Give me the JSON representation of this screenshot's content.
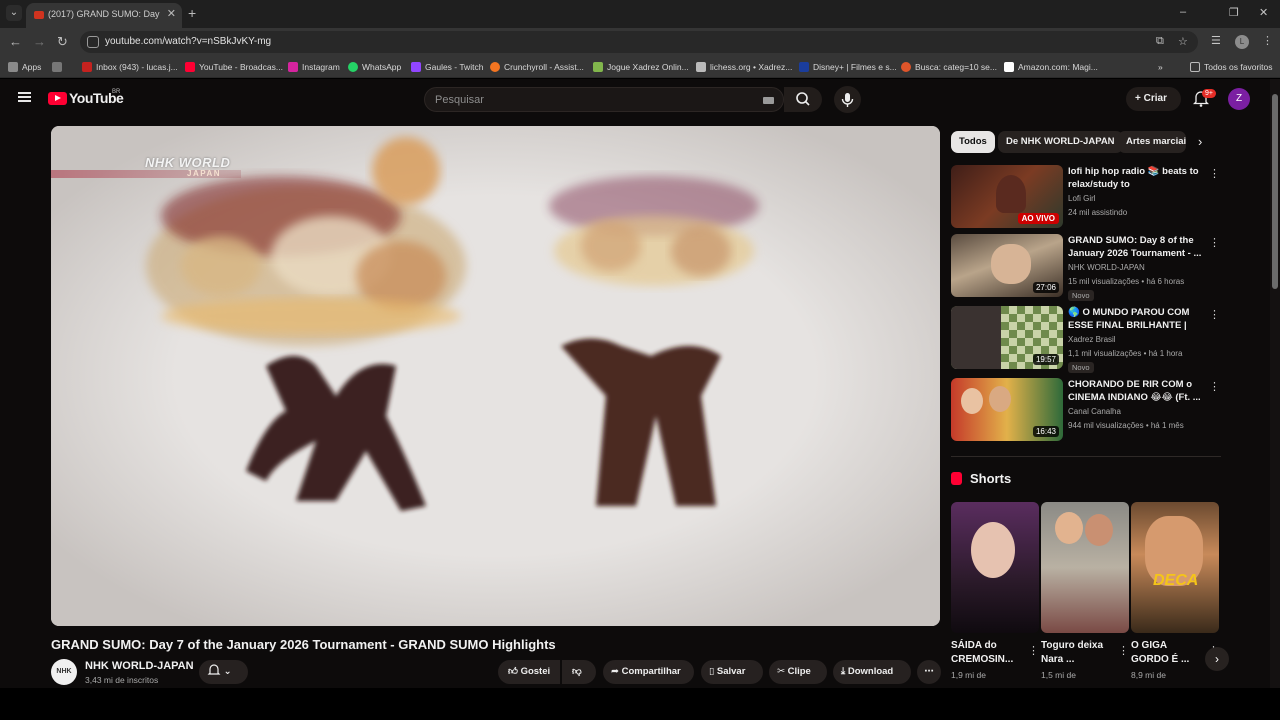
{
  "browser": {
    "tab_title": "(2017) GRAND SUMO: Day 7 of the January 2026 Tournament",
    "url": "youtube.com/watch?v=nSBkJvKY-mg",
    "profile_initial": "L",
    "bookmarks": [
      {
        "label": "Apps",
        "color": "#8a8a8a"
      },
      {
        "label": "Inbox (943) - lucas.j...",
        "color": "#c5221f"
      },
      {
        "label": "YouTube - Broadcas...",
        "color": "#ff0033"
      },
      {
        "label": "Instagram",
        "color": "#d6249f"
      },
      {
        "label": "WhatsApp",
        "color": "#25d366"
      },
      {
        "label": "Gaules - Twitch",
        "color": "#9146ff"
      },
      {
        "label": "Crunchyroll - Assist...",
        "color": "#f47521"
      },
      {
        "label": "Jogue Xadrez Onlin...",
        "color": "#81b64c"
      },
      {
        "label": "lichess.org • Xadrez...",
        "color": "#bbbbbb"
      },
      {
        "label": "Disney+ | Filmes e s...",
        "color": "#1a3d9c"
      },
      {
        "label": "Busca: categ=10 se...",
        "color": "#e0552a"
      },
      {
        "label": "Amazon.com: Magi...",
        "color": "#ffffff"
      }
    ],
    "all_bookmarks": "Todos os favoritos"
  },
  "masthead": {
    "logo_text": "YouTube",
    "country": "BR",
    "search_placeholder": "Pesquisar",
    "create_label": "Criar",
    "notif_badge": "9+",
    "avatar_initial": "Z"
  },
  "player": {
    "watermark_main": "NHK WORLD",
    "watermark_sub": "JAPAN"
  },
  "video": {
    "title": "GRAND SUMO: Day 7 of the January 2026 Tournament - GRAND SUMO Highlights",
    "channel": "NHK WORLD-JAPAN",
    "channel_avatar": "NHK",
    "subscribers": "3,43 mi de inscritos",
    "actions": {
      "like": "Gostei",
      "share": "Compartilhar",
      "save": "Salvar",
      "clip": "Clipe",
      "download": "Download"
    }
  },
  "chips": [
    "Todos",
    "De NHK WORLD-JAPAN",
    "Artes marciais"
  ],
  "recommendations": [
    {
      "title": "lofi hip hop radio 📚 beats to relax/study to",
      "channel": "Lofi Girl",
      "meta": "24 mil assistindo",
      "badge": "AO VIVO",
      "tag": ""
    },
    {
      "title": "GRAND SUMO: Day 8 of the January 2026 Tournament - ...",
      "channel": "NHK WORLD-JAPAN",
      "meta": "15 mil visualizações • há 6 horas",
      "badge": "27:06",
      "tag": "Novo"
    },
    {
      "title": "🌎 O MUNDO PAROU COM ESSE FINAL BRILHANTE | Tata...",
      "channel": "Xadrez Brasil",
      "meta": "1,1 mil visualizações • há 1 hora",
      "badge": "19:57",
      "tag": "Novo"
    },
    {
      "title": "CHORANDO DE RIR COM o CINEMA INDIANO 😂😂 (Ft. ...",
      "channel": "Canal Canalha",
      "meta": "944 mil visualizações • há 1 mês",
      "badge": "16:43",
      "tag": ""
    }
  ],
  "shorts": {
    "heading": "Shorts",
    "items": [
      {
        "title": "SÁIDA do CREMOSIN...",
        "meta": "1,9 mi de"
      },
      {
        "title": "Toguro deixa Nara ...",
        "meta": "1,5 mi de"
      },
      {
        "title": "O GIGA GORDO É ...",
        "meta": "8,9 mi de"
      }
    ]
  }
}
